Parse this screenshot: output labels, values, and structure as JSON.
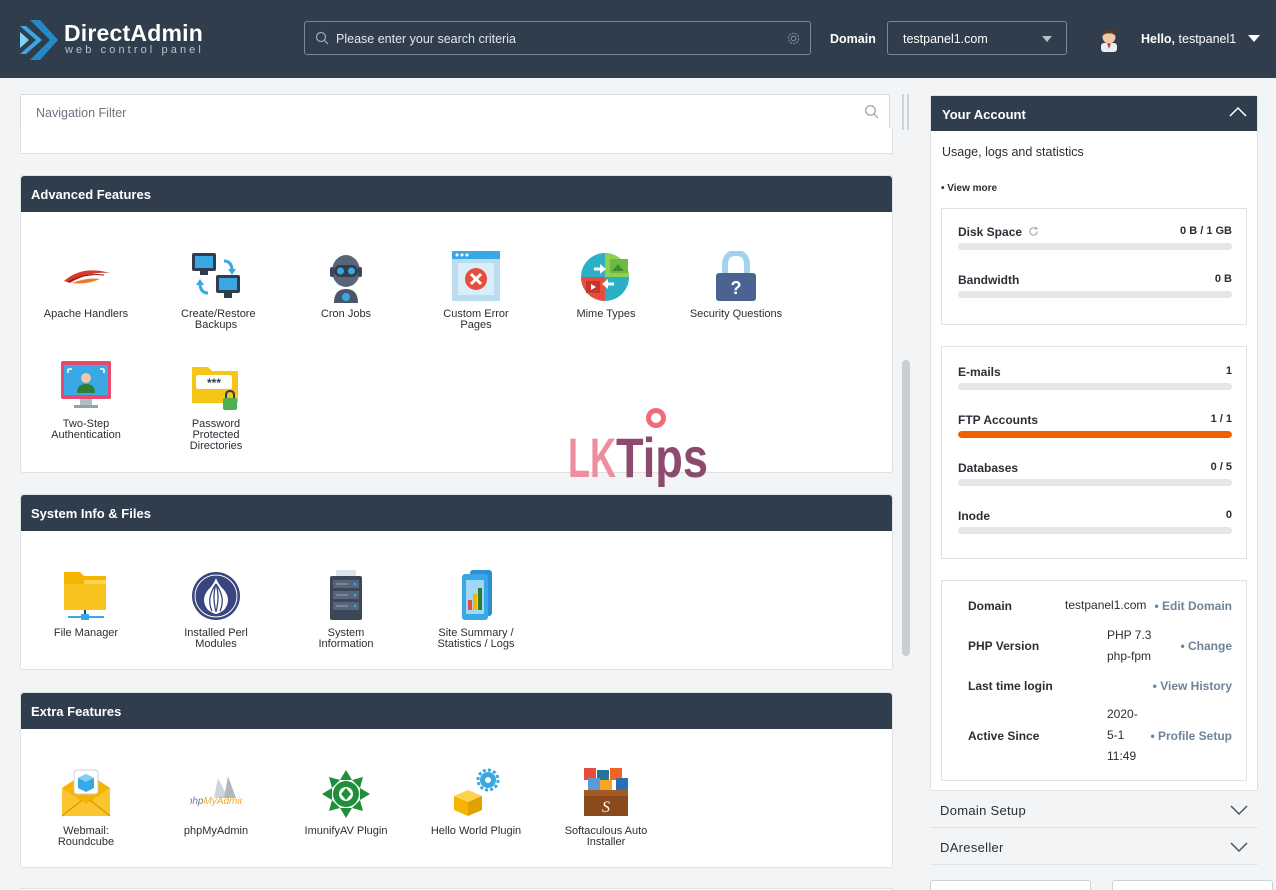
{
  "header": {
    "logo_title": "DirectAdmin",
    "logo_subtitle": "web control panel",
    "search_placeholder": "Please enter your search criteria",
    "domain_label": "Domain",
    "domain_value": "testpanel1.com",
    "hello_prefix": "Hello,",
    "username": "testpanel1"
  },
  "nav_filter": {
    "placeholder": "Navigation Filter"
  },
  "sections": [
    {
      "title": "Advanced Features",
      "items": [
        {
          "label": "Apache Handlers",
          "icon": "feather-icon"
        },
        {
          "label": "Create/Restore Backups",
          "icon": "backup-monitors-icon"
        },
        {
          "label": "Cron Jobs",
          "icon": "robot-icon"
        },
        {
          "label": "Custom Error Pages",
          "icon": "error-page-icon"
        },
        {
          "label": "Mime Types",
          "icon": "mime-types-icon"
        },
        {
          "label": "Security Questions",
          "icon": "padlock-question-icon"
        },
        {
          "label": "Two-Step Authentication",
          "icon": "monitor-user-icon"
        },
        {
          "label": "Password Protected Directories",
          "icon": "locked-folder-icon"
        }
      ]
    },
    {
      "title": "System Info & Files",
      "items": [
        {
          "label": "File Manager",
          "icon": "folder-icon"
        },
        {
          "label": "Installed Perl Modules",
          "icon": "perl-onion-icon"
        },
        {
          "label": "System Information",
          "icon": "server-icon"
        },
        {
          "label": "Site Summary / Statistics / Logs",
          "icon": "statistics-icon"
        }
      ]
    },
    {
      "title": "Extra Features",
      "items": [
        {
          "label": "Webmail: Roundcube",
          "icon": "envelope-icon"
        },
        {
          "label": "phpMyAdmin",
          "icon": "phpmyadmin-icon"
        },
        {
          "label": "ImunifyAV Plugin",
          "icon": "imunify-icon"
        },
        {
          "label": "Hello World Plugin",
          "icon": "box-gear-icon"
        },
        {
          "label": "Softaculous Auto Installer",
          "icon": "softaculous-icon"
        }
      ]
    }
  ],
  "account": {
    "title": "Your Account",
    "subtitle": "Usage, logs and statistics",
    "view_more": "• View more",
    "usage": [
      {
        "label": "Disk Space",
        "value": "0 B / 1 GB",
        "fraction": 0
      },
      {
        "label": "Bandwidth",
        "value": "0 B",
        "fraction": 0
      }
    ],
    "counts": [
      {
        "label": "E-mails",
        "value": "1",
        "fraction": 0
      },
      {
        "label": "FTP Accounts",
        "value": "1 / 1",
        "fraction": 1
      },
      {
        "label": "Databases",
        "value": "0 / 5",
        "fraction": 0
      },
      {
        "label": "Inode",
        "value": "0",
        "fraction": 0
      }
    ],
    "info": [
      {
        "key": "Domain",
        "value": "testpanel1.com",
        "action": "• Edit Domain"
      },
      {
        "key": "PHP Version",
        "value": "PHP 7.3 php-fpm",
        "action": "• Change"
      },
      {
        "key": "Last time login",
        "value": "",
        "action": "• View History"
      },
      {
        "key": "Active Since",
        "value": "2020-5-1 11:49",
        "action": "• Profile Setup"
      }
    ],
    "progress_color": "#f06000"
  },
  "collapsibles": [
    {
      "label": "Domain Setup"
    },
    {
      "label": "DAreseller"
    }
  ],
  "watermark": {
    "text": "LKTips"
  },
  "colors": {
    "header_bg": "#2f3d4c",
    "brand_blue": "#29a8e0",
    "accent_orange": "#f06000"
  }
}
